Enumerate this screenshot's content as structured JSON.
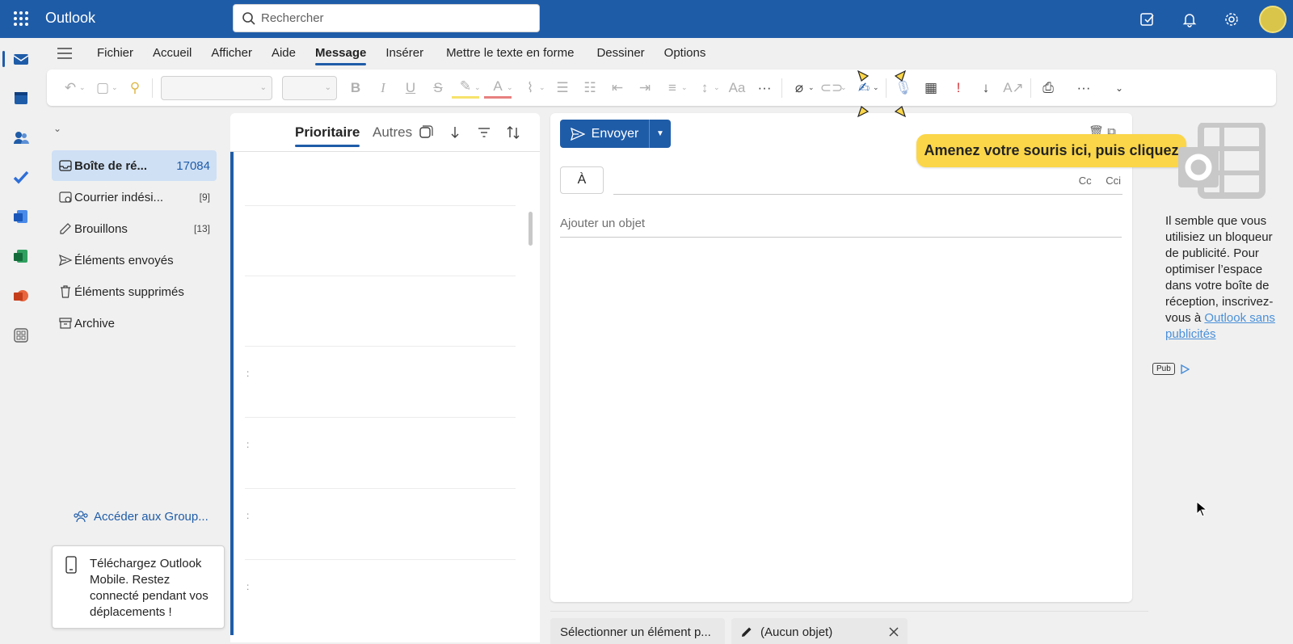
{
  "app": {
    "title": "Outlook"
  },
  "search": {
    "placeholder": "Rechercher"
  },
  "ribbon_tabs": [
    {
      "label": "Fichier"
    },
    {
      "label": "Accueil"
    },
    {
      "label": "Afficher"
    },
    {
      "label": "Aide"
    },
    {
      "label": "Message",
      "active": true
    },
    {
      "label": "Insérer"
    },
    {
      "label": "Mettre le texte en forme"
    },
    {
      "label": "Dessiner"
    },
    {
      "label": "Options"
    }
  ],
  "folders": [
    {
      "label": "Boîte de ré...",
      "count": "17084",
      "icon": "inbox-icon",
      "selected": true
    },
    {
      "label": "Courrier indési...",
      "count": "[9]",
      "icon": "junk-icon"
    },
    {
      "label": "Brouillons",
      "count": "[13]",
      "icon": "drafts-icon"
    },
    {
      "label": "Éléments envoyés",
      "count": "",
      "icon": "sent-icon"
    },
    {
      "label": "Éléments supprimés",
      "count": "",
      "icon": "trash-icon"
    },
    {
      "label": "Archive",
      "count": "",
      "icon": "archive-icon"
    }
  ],
  "groups_link": "Accéder aux Group...",
  "mobile_promo": "Téléchargez Outlook Mobile. Restez connecté pendant vos déplacements !",
  "message_list": {
    "focused_tab": "Prioritaire",
    "other_tab": "Autres"
  },
  "compose": {
    "send_label": "Envoyer",
    "to_label": "À",
    "cc_label": "Cc",
    "bcc_label": "Cci",
    "subject_placeholder": "Ajouter un objet"
  },
  "hint": "Amenez votre souris ici, puis cliquez",
  "ad": {
    "text": "Il semble que vous utilisiez un bloqueur de publicité. Pour optimiser l’espace dans votre boîte de réception, inscrivez-vous à ",
    "link": "Outlook sans publicités",
    "badge": "Pub"
  },
  "bottom_tabs": [
    {
      "label": "Sélectionner un élément p..."
    },
    {
      "label": "(Aucun objet)"
    }
  ],
  "colors": {
    "brand": "#1f5ca8",
    "hint": "#fbd649",
    "selected_folder": "#cfe0f5"
  }
}
